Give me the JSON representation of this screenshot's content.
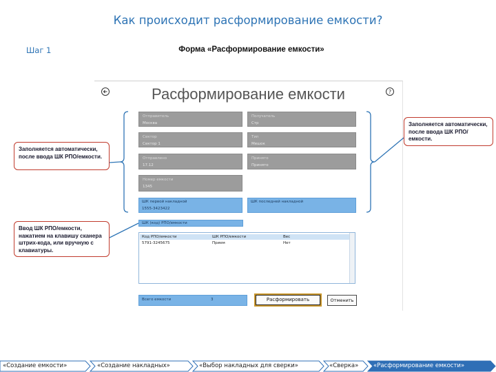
{
  "slide": {
    "title": "Как происходит расформирование емкости?",
    "step": "Шаг 1",
    "caption": "Форма «Расформирование емкости»"
  },
  "form": {
    "title": "Расформирование емкости",
    "back_icon": "back-arrow-icon",
    "help_icon": "question-icon",
    "gray_fields": [
      {
        "label": "Отправитель",
        "value": "Москва"
      },
      {
        "label": "Получатель",
        "value": "Стр"
      },
      {
        "label": "Сектор",
        "value": "Сектор 1"
      },
      {
        "label": "Тип",
        "value": "Мешок"
      },
      {
        "label": "Отправлено",
        "value": "17.12"
      },
      {
        "label": "Принято",
        "value": "Принято"
      },
      {
        "label": "Номер емкости",
        "value": "1345"
      }
    ],
    "blue_fields": [
      {
        "label": "ШК первой накладной",
        "value": "1555-3423422"
      },
      {
        "label": "ШК последней накладной",
        "value": ""
      }
    ],
    "scan_label": "ШК (код) РПО/емкости",
    "table": {
      "rows": [
        [
          "Код РПО/емкости",
          "ШК РПО/емкости",
          "Вес"
        ],
        [
          "5791-3245675",
          "Прием",
          "Нет"
        ]
      ]
    },
    "total_label": "Всего емкости",
    "total_value": "3",
    "disband_label": "Расформировать",
    "cancel_label": "Отменить"
  },
  "callouts": {
    "left": "Заполняется автоматически, после ввода ШК РПО/емкости.",
    "right": "Заполняется автоматически, после ввода ШК РПО/емкости.",
    "scan": "Ввод ШК РПО/емкости, нажатием на клавишу сканера штрих-кода, или вручную с клавиатуры."
  },
  "breadcrumb": {
    "items": [
      {
        "label": "«Создание емкости»",
        "active": false
      },
      {
        "label": "«Создание накладных»",
        "active": false
      },
      {
        "label": "«Выбор накладных для сверки»",
        "active": false
      },
      {
        "label": "«Сверка»",
        "active": false
      },
      {
        "label": "«Расформирование емкости»",
        "active": true
      }
    ]
  },
  "colors": {
    "title_blue": "#2e74b5",
    "callout_red": "#c0392b",
    "field_gray": "#9c9c9c",
    "field_blue": "#79b3e6",
    "crumb_active": "#2f6fb6",
    "button_border": "#c9962c"
  }
}
